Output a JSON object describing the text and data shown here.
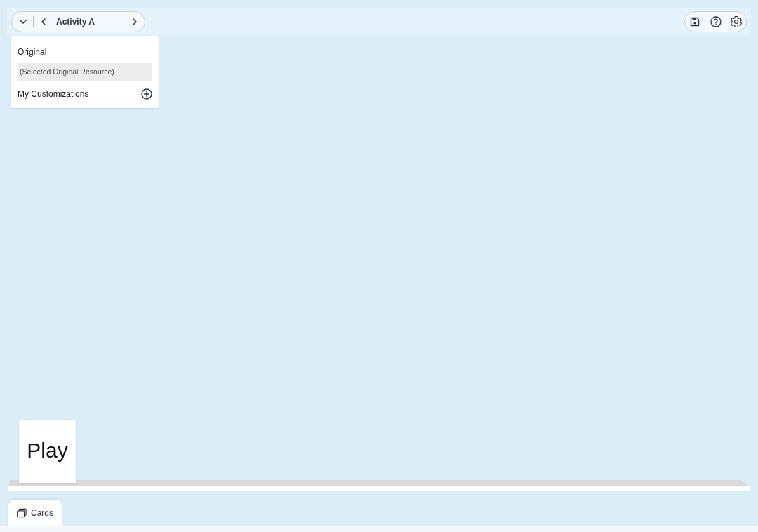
{
  "toolbar": {
    "activity_title": "Activity A"
  },
  "resource_menu": {
    "original_heading": "Original",
    "original_items": [
      {
        "label": "(Selected Original Resource)",
        "selected": true
      }
    ],
    "customizations_heading": "My Customizations"
  },
  "stage": {
    "cards": [
      {
        "label": "Play"
      }
    ]
  },
  "bottom_tabs": [
    {
      "label": "Cards"
    }
  ]
}
